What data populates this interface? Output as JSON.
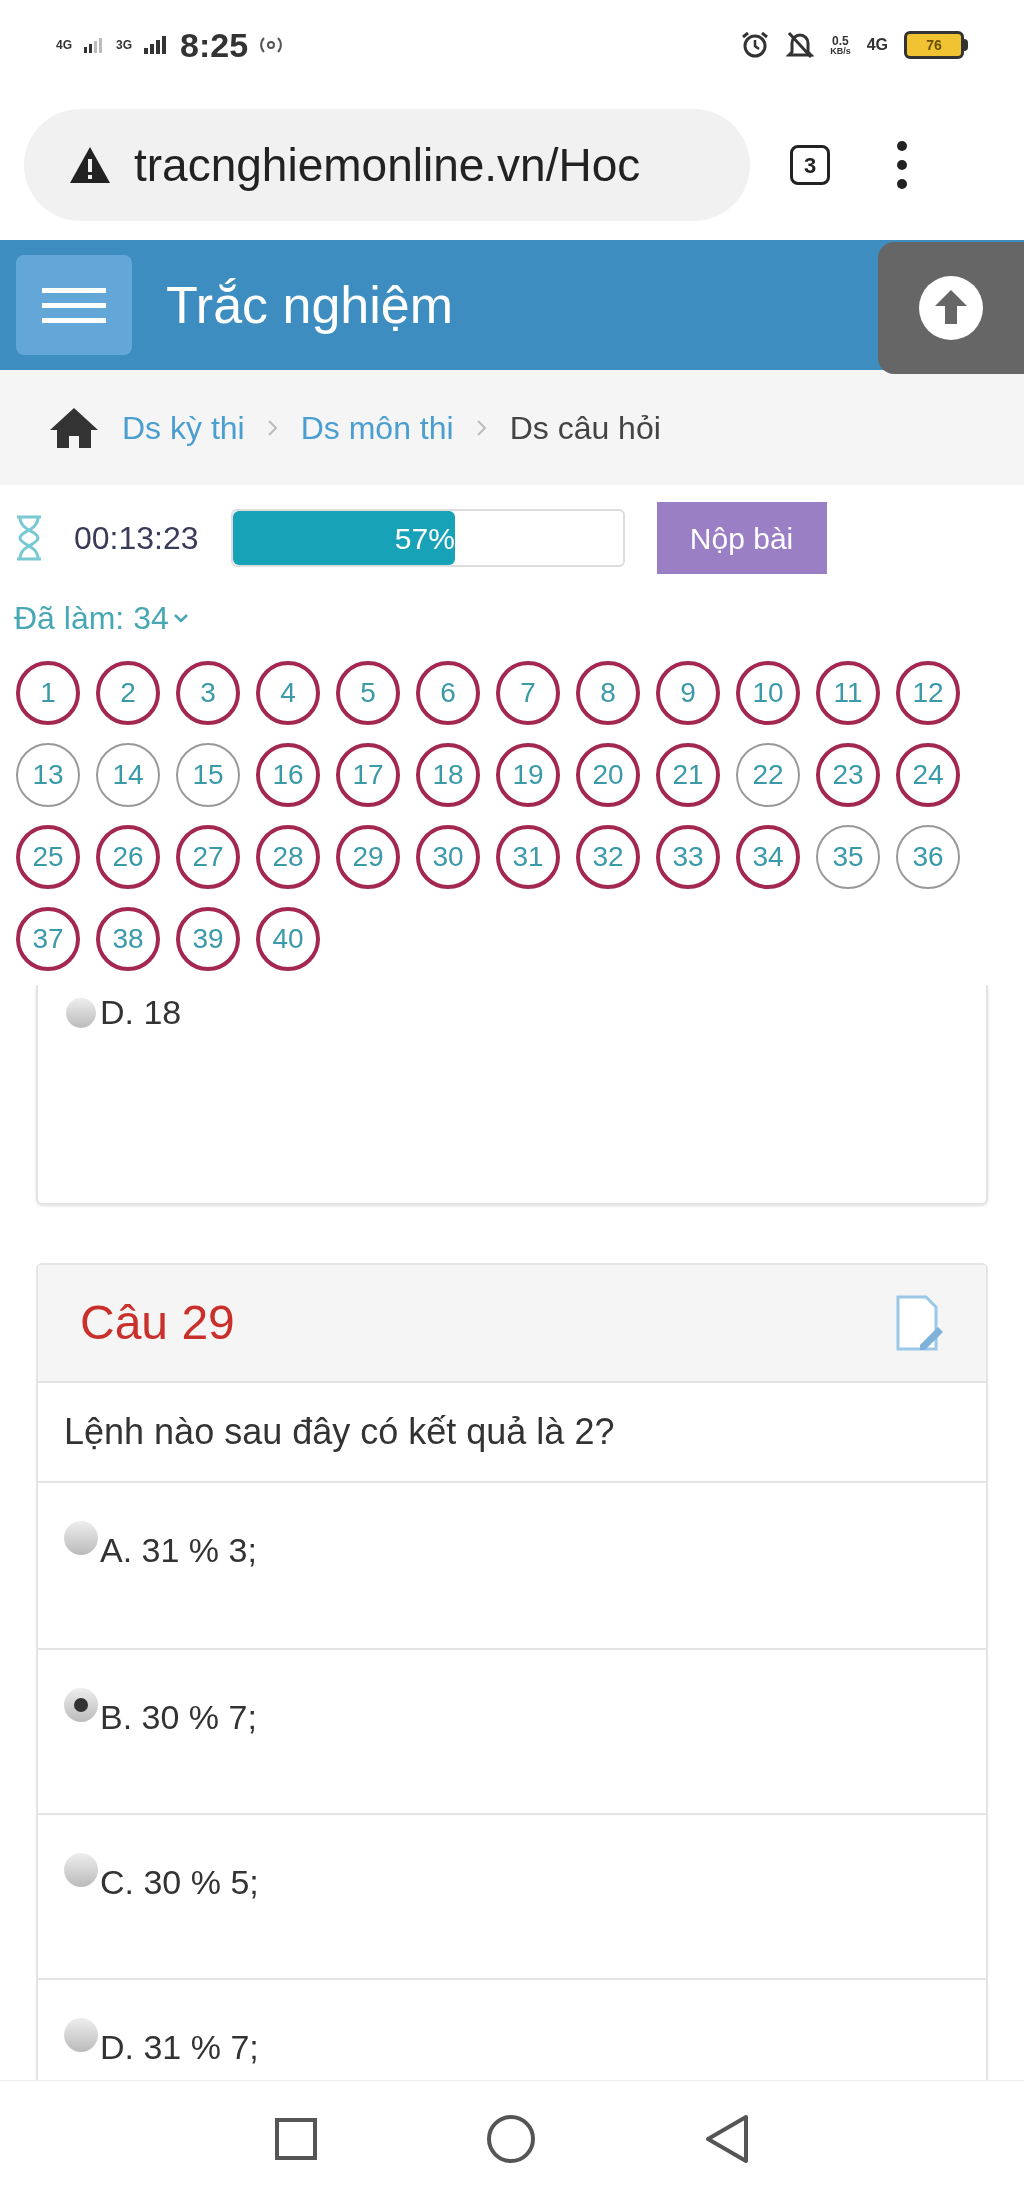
{
  "status_bar": {
    "network_1": "4G",
    "network_2": "3G",
    "time": "8:25",
    "speed": "0.5",
    "speed_unit": "KB/s",
    "network_3": "4G",
    "battery": "76"
  },
  "browser": {
    "url": "tracnghiemonline.vn/Hoc",
    "tab_count": "3"
  },
  "header": {
    "title": "Trắc nghiệm"
  },
  "breadcrumb": [
    {
      "label": "Ds kỳ thi",
      "selected": false
    },
    {
      "label": "Ds môn thi",
      "selected": false
    },
    {
      "label": "Ds câu hỏi",
      "selected": true
    }
  ],
  "timer": {
    "time": "00:13:23"
  },
  "progress": {
    "level": 0.57,
    "label": "57%"
  },
  "submit_button": "Nộp bài",
  "answered_label": "Đã làm: 34",
  "question_numbers": [
    {
      "number": "1",
      "answered": true
    },
    {
      "number": "2",
      "answered": true
    },
    {
      "number": "3",
      "answered": true
    },
    {
      "number": "4",
      "answered": true
    },
    {
      "number": "5",
      "answered": true
    },
    {
      "number": "6",
      "answered": true
    },
    {
      "number": "7",
      "answered": true
    },
    {
      "number": "8",
      "answered": true
    },
    {
      "number": "9",
      "answered": true
    },
    {
      "number": "10",
      "answered": true
    },
    {
      "number": "11",
      "answered": true
    },
    {
      "number": "12",
      "answered": true
    },
    {
      "number": "13",
      "answered": false
    },
    {
      "number": "14",
      "answered": false
    },
    {
      "number": "15",
      "answered": false
    },
    {
      "number": "16",
      "answered": true
    },
    {
      "number": "17",
      "answered": true
    },
    {
      "number": "18",
      "answered": true
    },
    {
      "number": "19",
      "answered": true
    },
    {
      "number": "20",
      "answered": true
    },
    {
      "number": "21",
      "answered": true
    },
    {
      "number": "22",
      "answered": false
    },
    {
      "number": "23",
      "answered": true
    },
    {
      "number": "24",
      "answered": true
    },
    {
      "number": "25",
      "answered": true
    },
    {
      "number": "26",
      "answered": true
    },
    {
      "number": "27",
      "answered": true
    },
    {
      "number": "28",
      "answered": true
    },
    {
      "number": "29",
      "answered": true
    },
    {
      "number": "30",
      "answered": true
    },
    {
      "number": "31",
      "answered": true
    },
    {
      "number": "32",
      "answered": true
    },
    {
      "number": "33",
      "answered": true
    },
    {
      "number": "34",
      "answered": true
    },
    {
      "number": "35",
      "answered": false
    },
    {
      "number": "36",
      "answered": false
    },
    {
      "number": "37",
      "answered": true
    },
    {
      "number": "38",
      "answered": true
    },
    {
      "number": "39",
      "answered": true
    },
    {
      "number": "40",
      "answered": true
    }
  ],
  "previous_card": {
    "option": "D. 18",
    "selected": false
  },
  "question": {
    "title": "Câu 29",
    "text": "Lệnh nào sau đây có kết quả là 2?",
    "options": [
      {
        "label": "A. 31 % 3;",
        "selected": false
      },
      {
        "label": "B. 30 % 7;",
        "selected": true
      },
      {
        "label": "C. 30 % 5;",
        "selected": false
      },
      {
        "label": "D. 31 % 7;",
        "selected": false
      }
    ]
  }
}
